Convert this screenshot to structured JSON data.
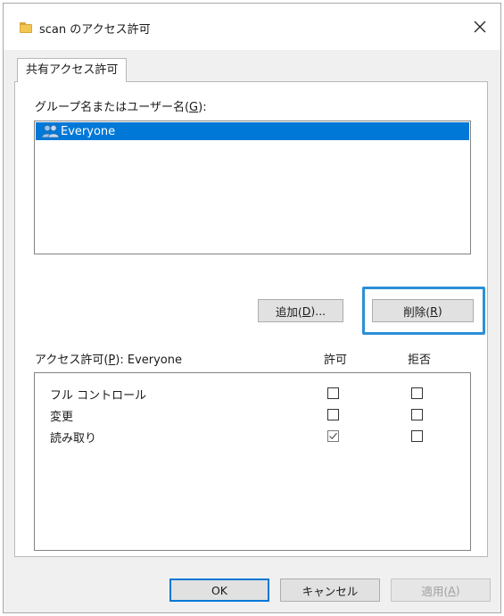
{
  "window": {
    "title": "scan のアクセス許可",
    "icon": "folder-icon",
    "close_icon": "close-icon"
  },
  "tabs": [
    {
      "label": "共有アクセス許可",
      "active": true
    }
  ],
  "groups": {
    "label_prefix": "グループ名またはユーザー名(",
    "label_key": "G",
    "label_suffix": "):",
    "items": [
      {
        "name": "Everyone",
        "icon": "users-icon",
        "selected": true
      }
    ]
  },
  "buttons": {
    "add": {
      "label": "追加(",
      "key": "D",
      "suffix": ")..."
    },
    "remove": {
      "label": "削除(",
      "key": "R",
      "suffix": ")",
      "highlighted": true
    }
  },
  "permissions": {
    "label_prefix": "アクセス許可(",
    "label_key": "P",
    "label_suffix": "): Everyone",
    "allow_header": "許可",
    "deny_header": "拒否",
    "rows": [
      {
        "name": "フル コントロール",
        "allow": false,
        "deny": false
      },
      {
        "name": "変更",
        "allow": false,
        "deny": false
      },
      {
        "name": "読み取り",
        "allow": true,
        "deny": false
      }
    ]
  },
  "footer": {
    "ok": {
      "label": "OK"
    },
    "cancel": {
      "label": "キャンセル"
    },
    "apply": {
      "label": "適用(",
      "key": "A",
      "suffix": ")",
      "disabled": true
    }
  },
  "colors": {
    "selection": "#0078d7",
    "highlight_frame": "#2d8fd6",
    "dialog_background": "#f0f0f0"
  }
}
